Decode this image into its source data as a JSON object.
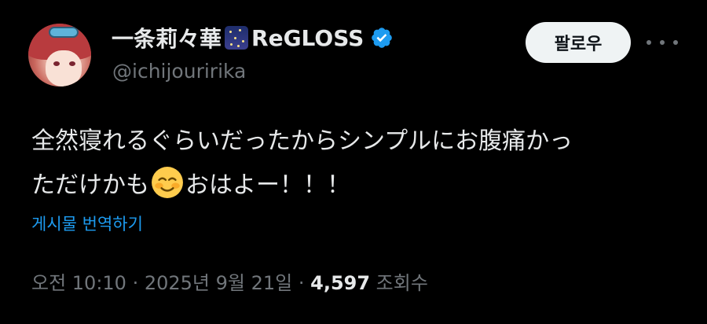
{
  "author": {
    "display_name": "一条莉々華",
    "team_name": "ReGLOSS",
    "handle": "@ichijouririka",
    "avatar": "avatar-image",
    "verified_icon": "verified-badge-icon"
  },
  "actions": {
    "follow_label": "팔로우",
    "more_icon": "more-options-icon"
  },
  "tweet": {
    "line1": "全然寝れるぐらいだったからシンプルにお腹痛かっ",
    "line2_before": "ただけかも",
    "emoji": "smiling-face-icon",
    "line2_after": "おはよー！！！"
  },
  "translate_label": "게시물 번역하기",
  "meta": {
    "time": "오전 10:10",
    "sep1": " · ",
    "date": "2025년 9월 21일",
    "sep2": " · ",
    "views_count": "4,597",
    "views_label": " 조회수"
  },
  "colors": {
    "background": "#000000",
    "text": "#e7e9ea",
    "muted": "#71767b",
    "link": "#1d9bf0",
    "verified": "#1d9bf0",
    "follow_bg": "#eff3f4"
  }
}
